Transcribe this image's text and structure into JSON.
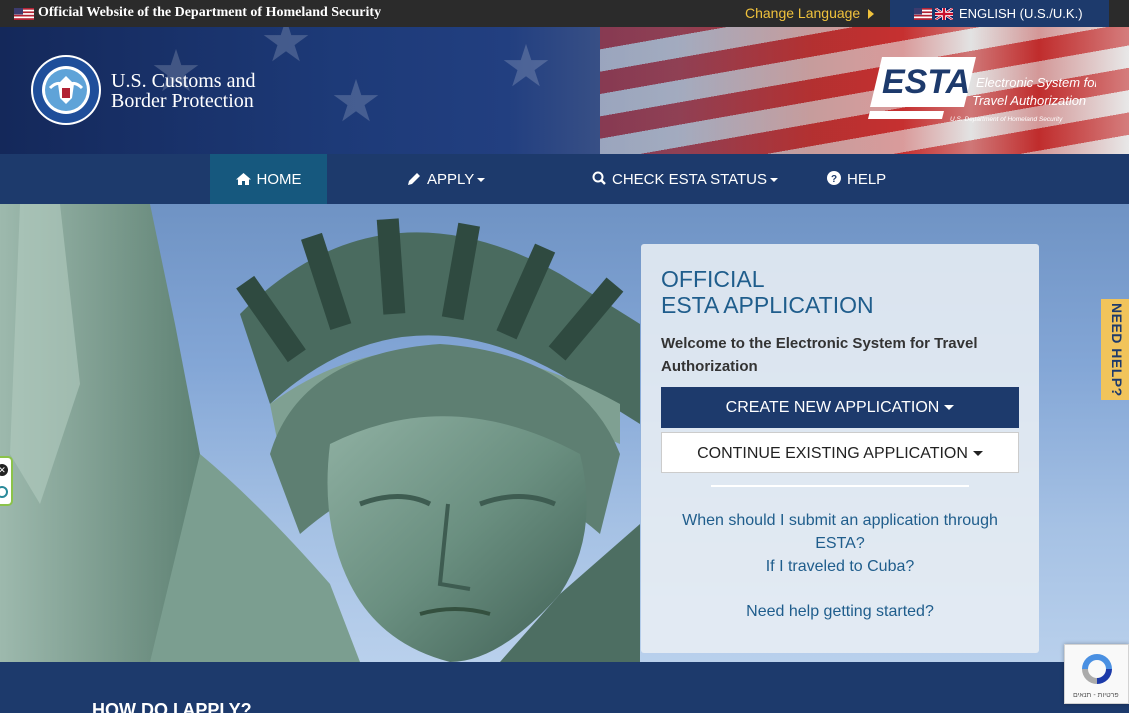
{
  "govbar": {
    "official_text": "Official Website of the Department of Homeland Security",
    "change_language": "Change Language",
    "current_language": "ENGLISH (U.S./U.K.)"
  },
  "header": {
    "agency_line1": "U.S. Customs and",
    "agency_line2": "Border Protection",
    "esta_wordmark": "ESTA",
    "esta_line1": "Electronic System for",
    "esta_line2": "Travel Authorization",
    "esta_line3": "U.S. Department of Homeland Security"
  },
  "nav": {
    "items": [
      {
        "label": "HOME",
        "icon": "home-icon",
        "active": true
      },
      {
        "label": "APPLY",
        "icon": "pencil-icon",
        "dropdown": true
      },
      {
        "label": "CHECK ESTA STATUS",
        "icon": "search-icon",
        "dropdown": true
      },
      {
        "label": "HELP",
        "icon": "question-circle-icon"
      }
    ]
  },
  "panel": {
    "title_line1": "OFFICIAL",
    "title_line2": "ESTA APPLICATION",
    "welcome": "Welcome to the Electronic System for Travel Authorization",
    "create_button": "CREATE NEW APPLICATION",
    "continue_button": "CONTINUE EXISTING APPLICATION",
    "links": [
      "When should I submit an application through ESTA?",
      "If I traveled to Cuba?",
      "Need help getting started?"
    ]
  },
  "need_help_tab": "NEED HELP?",
  "section": {
    "heading": "HOW DO I APPLY?"
  },
  "recaptcha": {
    "terms": "פרטיות - תנאים"
  },
  "colors": {
    "navy": "#1d3a6c",
    "active_tab": "#16587e",
    "gold": "#f0c23c",
    "link_blue": "#1f5d8c",
    "help_tab": "#f1c45b"
  }
}
